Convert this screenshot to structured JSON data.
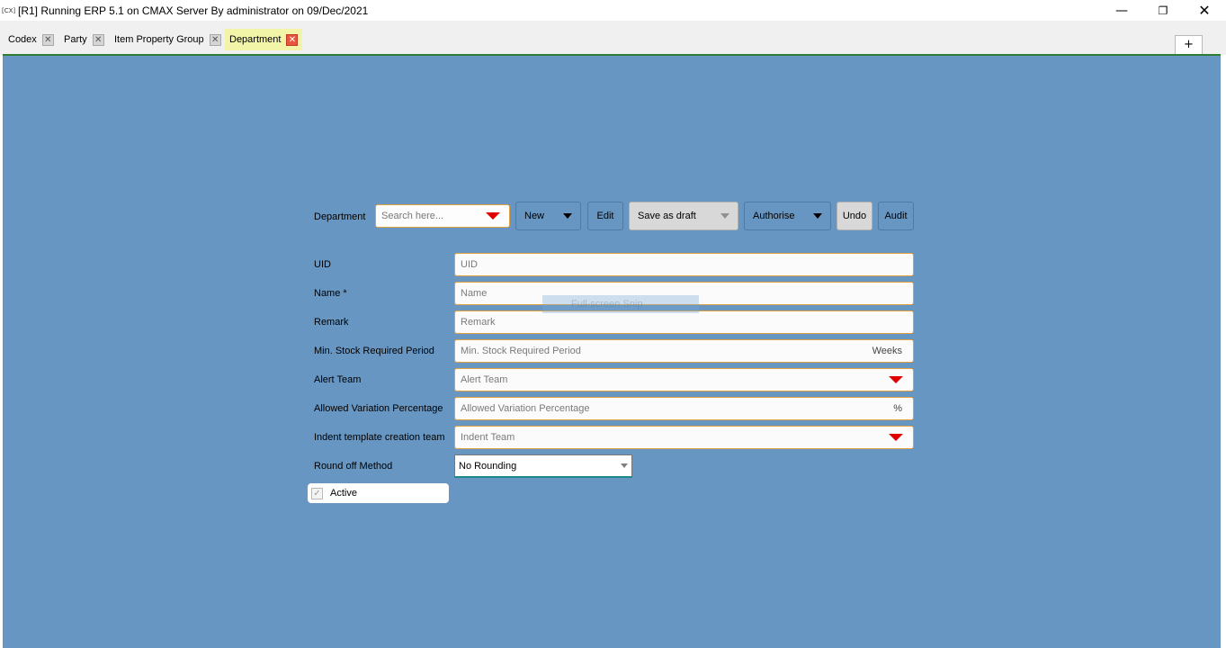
{
  "titlebar": {
    "icon_text": "[CX]",
    "title": "[R1] Running ERP 5.1 on CMAX Server By administrator on 09/Dec/2021",
    "minimize": "—",
    "maximize": "❐",
    "close": "✕"
  },
  "tabs": [
    {
      "label": "Codex",
      "close": "✕",
      "active": false
    },
    {
      "label": "Party",
      "close": "✕",
      "active": false
    },
    {
      "label": "Item Property Group",
      "close": "✕",
      "active": false
    },
    {
      "label": "Department",
      "close": "✕",
      "active": true
    }
  ],
  "add_tab": "+",
  "toolbar": {
    "label": "Department",
    "search_placeholder": "Search here...",
    "new_label": "New",
    "edit_label": "Edit",
    "save_draft_label": "Save as draft",
    "authorise_label": "Authorise",
    "undo_label": "Undo",
    "audit_label": "Audit"
  },
  "form": {
    "uid": {
      "label": "UID",
      "placeholder": "UID"
    },
    "name": {
      "label": "Name *",
      "placeholder": "Name"
    },
    "remark": {
      "label": "Remark",
      "placeholder": "Remark"
    },
    "min_stock": {
      "label": "Min. Stock Required Period",
      "placeholder": "Min. Stock Required Period",
      "suffix": "Weeks"
    },
    "alert_team": {
      "label": "Alert Team",
      "placeholder": "Alert Team"
    },
    "allowed_variation": {
      "label": "Allowed Variation Percentage",
      "placeholder": "Allowed Variation Percentage",
      "suffix": "%"
    },
    "indent_team": {
      "label": "Indent template creation team",
      "placeholder": "Indent Team"
    },
    "round_off": {
      "label": "Round off Method",
      "value": "No Rounding"
    },
    "active": {
      "label": "Active",
      "checked": true,
      "check_glyph": "✓"
    }
  },
  "overlay": {
    "ghost_text": "Full-screen Snip"
  },
  "colors": {
    "background": "#6796c2",
    "field_border": "#e0a040",
    "dropdown_arrow": "#e00000",
    "active_tab": "#f2f5a8",
    "tab_underline": "#2e7d32"
  }
}
